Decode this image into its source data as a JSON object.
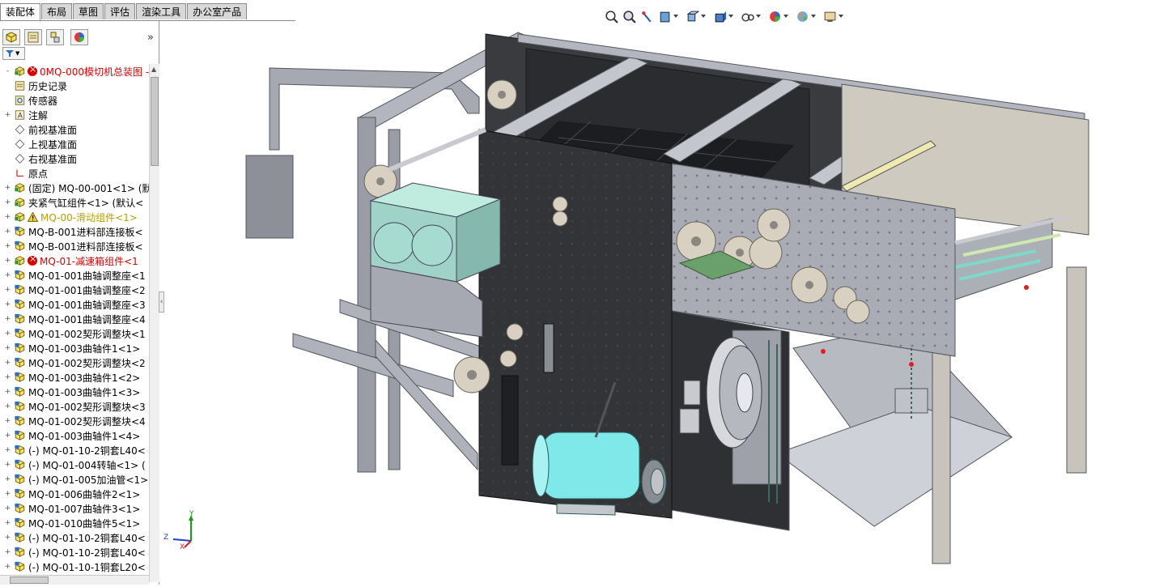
{
  "command_tabs": [
    "装配体",
    "布局",
    "草图",
    "评估",
    "渲染工具",
    "办公室产品"
  ],
  "active_tab": 0,
  "hud_icons": [
    "zoom-to-fit-icon",
    "zoom-area-icon",
    "previous-view-icon",
    "section-view-icon",
    "view-orientation-icon",
    "display-style-icon",
    "hide-show-items-icon",
    "edit-appearance-icon",
    "apply-scene-icon",
    "view-settings-icon"
  ],
  "panel": {
    "tab_icons": [
      "feature-manager-icon",
      "property-manager-icon",
      "configuration-manager-icon",
      "display-manager-icon"
    ],
    "more_label": "»",
    "filter_icon": "filter-icon"
  },
  "tree": [
    {
      "label": "0MQ-000模切机总装图 - (",
      "icon": "assembly-icon",
      "state": "error",
      "color": "#e00000",
      "expand": "-"
    },
    {
      "label": "历史记录",
      "icon": "history-icon",
      "color": "#000000",
      "expand": ""
    },
    {
      "label": "传感器",
      "icon": "sensor-icon",
      "color": "#000000",
      "expand": ""
    },
    {
      "label": "注解",
      "icon": "annotation-icon",
      "color": "#000000",
      "expand": "+"
    },
    {
      "label": "前视基准面",
      "icon": "plane-icon",
      "color": "#000000",
      "expand": ""
    },
    {
      "label": "上视基准面",
      "icon": "plane-icon",
      "color": "#000000",
      "expand": ""
    },
    {
      "label": "右视基准面",
      "icon": "plane-icon",
      "color": "#000000",
      "expand": ""
    },
    {
      "label": "原点",
      "icon": "origin-icon",
      "color": "#000000",
      "expand": ""
    },
    {
      "label": "(固定) MQ-00-001<1> (默",
      "icon": "assembly-icon",
      "color": "#000000",
      "expand": "+"
    },
    {
      "label": "夹紧气缸组件<1> (默认<",
      "icon": "assembly-icon",
      "color": "#000000",
      "expand": "+"
    },
    {
      "label": "MQ-00-滑动组件<1>",
      "icon": "assembly-icon",
      "state": "warning",
      "color": "#b8a000",
      "expand": "+"
    },
    {
      "label": "MQ-B-001进料部连接板<",
      "icon": "part-icon",
      "color": "#000000",
      "expand": "+"
    },
    {
      "label": "MQ-B-001进料部连接板<",
      "icon": "part-icon",
      "color": "#000000",
      "expand": "+"
    },
    {
      "label": "MQ-01-减速箱组件<1",
      "icon": "assembly-icon",
      "state": "error",
      "color": "#e00000",
      "expand": "+"
    },
    {
      "label": "MQ-01-001曲轴调整座<1",
      "icon": "part-icon",
      "color": "#000000",
      "expand": "+"
    },
    {
      "label": "MQ-01-001曲轴调整座<2",
      "icon": "part-icon",
      "color": "#000000",
      "expand": "+"
    },
    {
      "label": "MQ-01-001曲轴调整座<3",
      "icon": "part-icon",
      "color": "#000000",
      "expand": "+"
    },
    {
      "label": "MQ-01-001曲轴调整座<4",
      "icon": "part-icon",
      "color": "#000000",
      "expand": "+"
    },
    {
      "label": "MQ-01-002契形调整块<1",
      "icon": "part-icon",
      "color": "#000000",
      "expand": "+"
    },
    {
      "label": "MQ-01-003曲轴件1<1>",
      "icon": "part-icon",
      "color": "#000000",
      "expand": "+"
    },
    {
      "label": "MQ-01-002契形调整块<2",
      "icon": "part-icon",
      "color": "#000000",
      "expand": "+"
    },
    {
      "label": "MQ-01-003曲轴件1<2>",
      "icon": "part-icon",
      "color": "#000000",
      "expand": "+"
    },
    {
      "label": "MQ-01-003曲轴件1<3>",
      "icon": "part-icon",
      "color": "#000000",
      "expand": "+"
    },
    {
      "label": "MQ-01-002契形调整块<3",
      "icon": "part-icon",
      "color": "#000000",
      "expand": "+"
    },
    {
      "label": "MQ-01-002契形调整块<4",
      "icon": "part-icon",
      "color": "#000000",
      "expand": "+"
    },
    {
      "label": "MQ-01-003曲轴件1<4>",
      "icon": "part-icon",
      "color": "#000000",
      "expand": "+"
    },
    {
      "label": "(-) MQ-01-10-2铜套L40<",
      "icon": "part-icon",
      "color": "#000000",
      "expand": "+"
    },
    {
      "label": "(-) MQ-01-004转轴<1> (",
      "icon": "part-icon",
      "color": "#000000",
      "expand": "+"
    },
    {
      "label": "(-) MQ-01-005加油管<1>",
      "icon": "part-icon",
      "color": "#000000",
      "expand": "+"
    },
    {
      "label": "MQ-01-006曲轴件2<1>",
      "icon": "part-icon",
      "color": "#000000",
      "expand": "+"
    },
    {
      "label": "MQ-01-007曲轴件3<1>",
      "icon": "part-icon",
      "color": "#000000",
      "expand": "+"
    },
    {
      "label": "MQ-01-010曲轴件5<1>",
      "icon": "part-icon",
      "color": "#000000",
      "expand": "+"
    },
    {
      "label": "(-) MQ-01-10-2铜套L40<",
      "icon": "part-icon",
      "color": "#000000",
      "expand": "+"
    },
    {
      "label": "(-) MQ-01-10-2铜套L40<",
      "icon": "part-icon",
      "color": "#000000",
      "expand": "+"
    },
    {
      "label": "(-) MQ-01-10-1铜套L20<",
      "icon": "part-icon",
      "color": "#000000",
      "expand": "+"
    }
  ],
  "triad": {
    "x": "X",
    "y": "Y",
    "z": "Z"
  },
  "colors": {
    "frame": "#9a9ca6",
    "black_plate": "#2a2a2a",
    "motor": "#7fe8e8",
    "box": "#9fd3c7",
    "gear": "#d8d0c0",
    "error": "#e00000"
  }
}
